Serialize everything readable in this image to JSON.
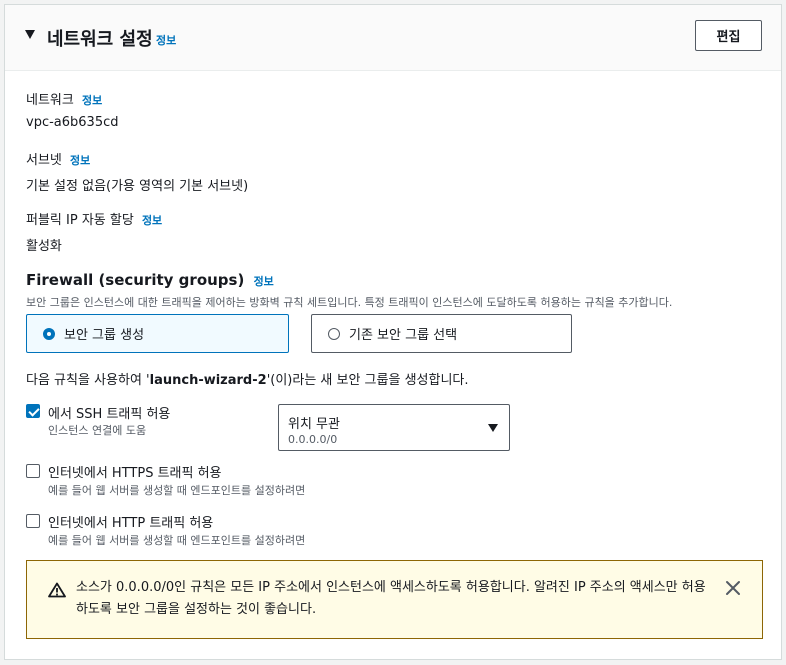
{
  "header": {
    "title": "네트워크 설정",
    "info": "정보",
    "edit_label": "편집"
  },
  "network": {
    "label": "네트워크",
    "info": "정보",
    "value": "vpc-a6b635cd"
  },
  "subnet": {
    "label": "서브넷",
    "info": "정보",
    "value": "기본 설정 없음(가용 영역의 기본 서브넷)"
  },
  "public_ip": {
    "label": "퍼블릭 IP 자동 할당",
    "info": "정보",
    "value": "활성화"
  },
  "firewall": {
    "title": "Firewall (security groups)",
    "info": "정보",
    "description": "보안 그룹은 인스턴스에 대한 트래픽을 제어하는 방화벽 규칙 세트입니다. 특정 트래픽이 인스턴스에 도달하도록 허용하는 규칙을 추가합니다.",
    "option_create": "보안 그룹 생성",
    "option_existing": "기존 보안 그룹 선택",
    "rule_prefix": "다음 규칙을 사용하여 '",
    "group_name": "launch-wizard-2",
    "rule_suffix": "'(이)라는 새 보안 그룹을 생성합니다."
  },
  "ssh": {
    "label": "에서 SSH 트래픽 허용",
    "desc": "인스턴스 연결에 도움",
    "checked": true,
    "source_label": "위치 무관",
    "source_value": "0.0.0.0/0"
  },
  "https": {
    "label": "인터넷에서 HTTPS 트래픽 허용",
    "desc": "예를 들어 웹 서버를 생성할 때 엔드포인트를 설정하려면",
    "checked": false
  },
  "http": {
    "label": "인터넷에서 HTTP 트래픽 허용",
    "desc": "예를 들어 웹 서버를 생성할 때 엔드포인트를 설정하려면",
    "checked": false
  },
  "alert": {
    "message": "소스가 0.0.0.0/0인 규칙은 모든 IP 주소에서 인스턴스에 액세스하도록 허용합니다. 알려진 IP 주소의 액세스만 허용하도록 보안 그룹을 설정하는 것이 좋습니다."
  },
  "colors": {
    "link": "#0073bb",
    "selected_tile_bg": "#f1faff",
    "warning_bg": "#fffce6",
    "warning_border": "#8d6605"
  }
}
